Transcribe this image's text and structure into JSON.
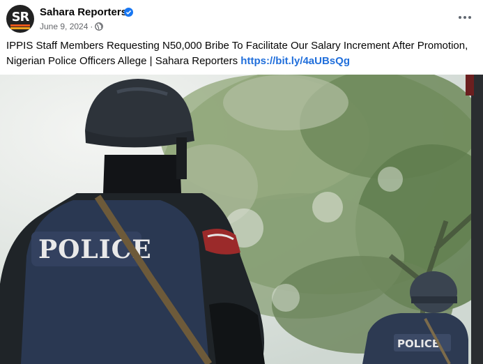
{
  "post": {
    "page_name": "Sahara Reporters",
    "date": "June 9, 2024",
    "separator": "·",
    "caption": "IPPIS Staff Members Requesting N50,000 Bribe To Facilitate Our Salary Increment After Promotion, Nigerian Police Officers Allege | Sahara Reporters ",
    "link_text": "https://bit.ly/4aUBsQg",
    "avatar_text": "SR"
  },
  "photo": {
    "vest_label_front": "POLICE",
    "vest_label_back": "POLICE"
  },
  "icons": {
    "verified": "verified-badge-icon",
    "audience": "globe-icon",
    "more": "more-options-icon"
  },
  "colors": {
    "link": "#216fdb",
    "verified": "#1877f2",
    "meta_text": "#65676b"
  }
}
